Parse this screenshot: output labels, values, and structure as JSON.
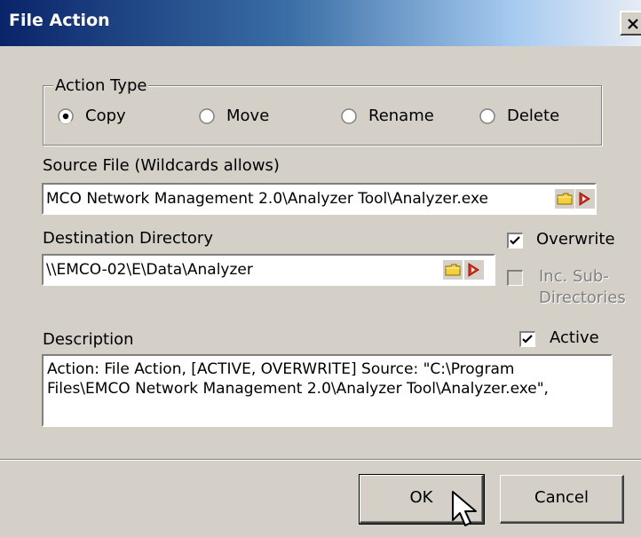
{
  "window": {
    "title": "File Action",
    "close_glyph": "x"
  },
  "action_type": {
    "label": "Action Type",
    "options": [
      {
        "label": "Copy",
        "selected": true
      },
      {
        "label": "Move",
        "selected": false
      },
      {
        "label": "Rename",
        "selected": false
      },
      {
        "label": "Delete",
        "selected": false
      }
    ]
  },
  "source": {
    "label": "Source File (Wildcards allows)",
    "value": "MCO Network Management 2.0\\Analyzer Tool\\Analyzer.exe",
    "browse_icon": "folder-icon",
    "clear_icon": "arrow-eraser-icon"
  },
  "destination": {
    "label": "Destination Directory",
    "value": "\\\\EMCO-02\\E\\Data\\Analyzer",
    "browse_icon": "folder-icon",
    "clear_icon": "arrow-eraser-icon"
  },
  "options": {
    "overwrite": {
      "label": "Overwrite",
      "checked": true,
      "enabled": true
    },
    "inc_sub": {
      "label_line1": "Inc. Sub-",
      "label_line2": "Directories",
      "checked": false,
      "enabled": false
    }
  },
  "description": {
    "label": "Description",
    "active_label": "Active",
    "active_checked": true,
    "text": "Action: File Action, [ACTIVE, OVERWRITE] Source: \"C:\\Program\nFiles\\EMCO Network Management 2.0\\Analyzer Tool\\Analyzer.exe\","
  },
  "buttons": {
    "ok": "OK",
    "cancel": "Cancel"
  },
  "colors": {
    "dialog_bg": "#d4d0c8",
    "title_start": "#0a246a",
    "title_end": "#a6caf0"
  }
}
